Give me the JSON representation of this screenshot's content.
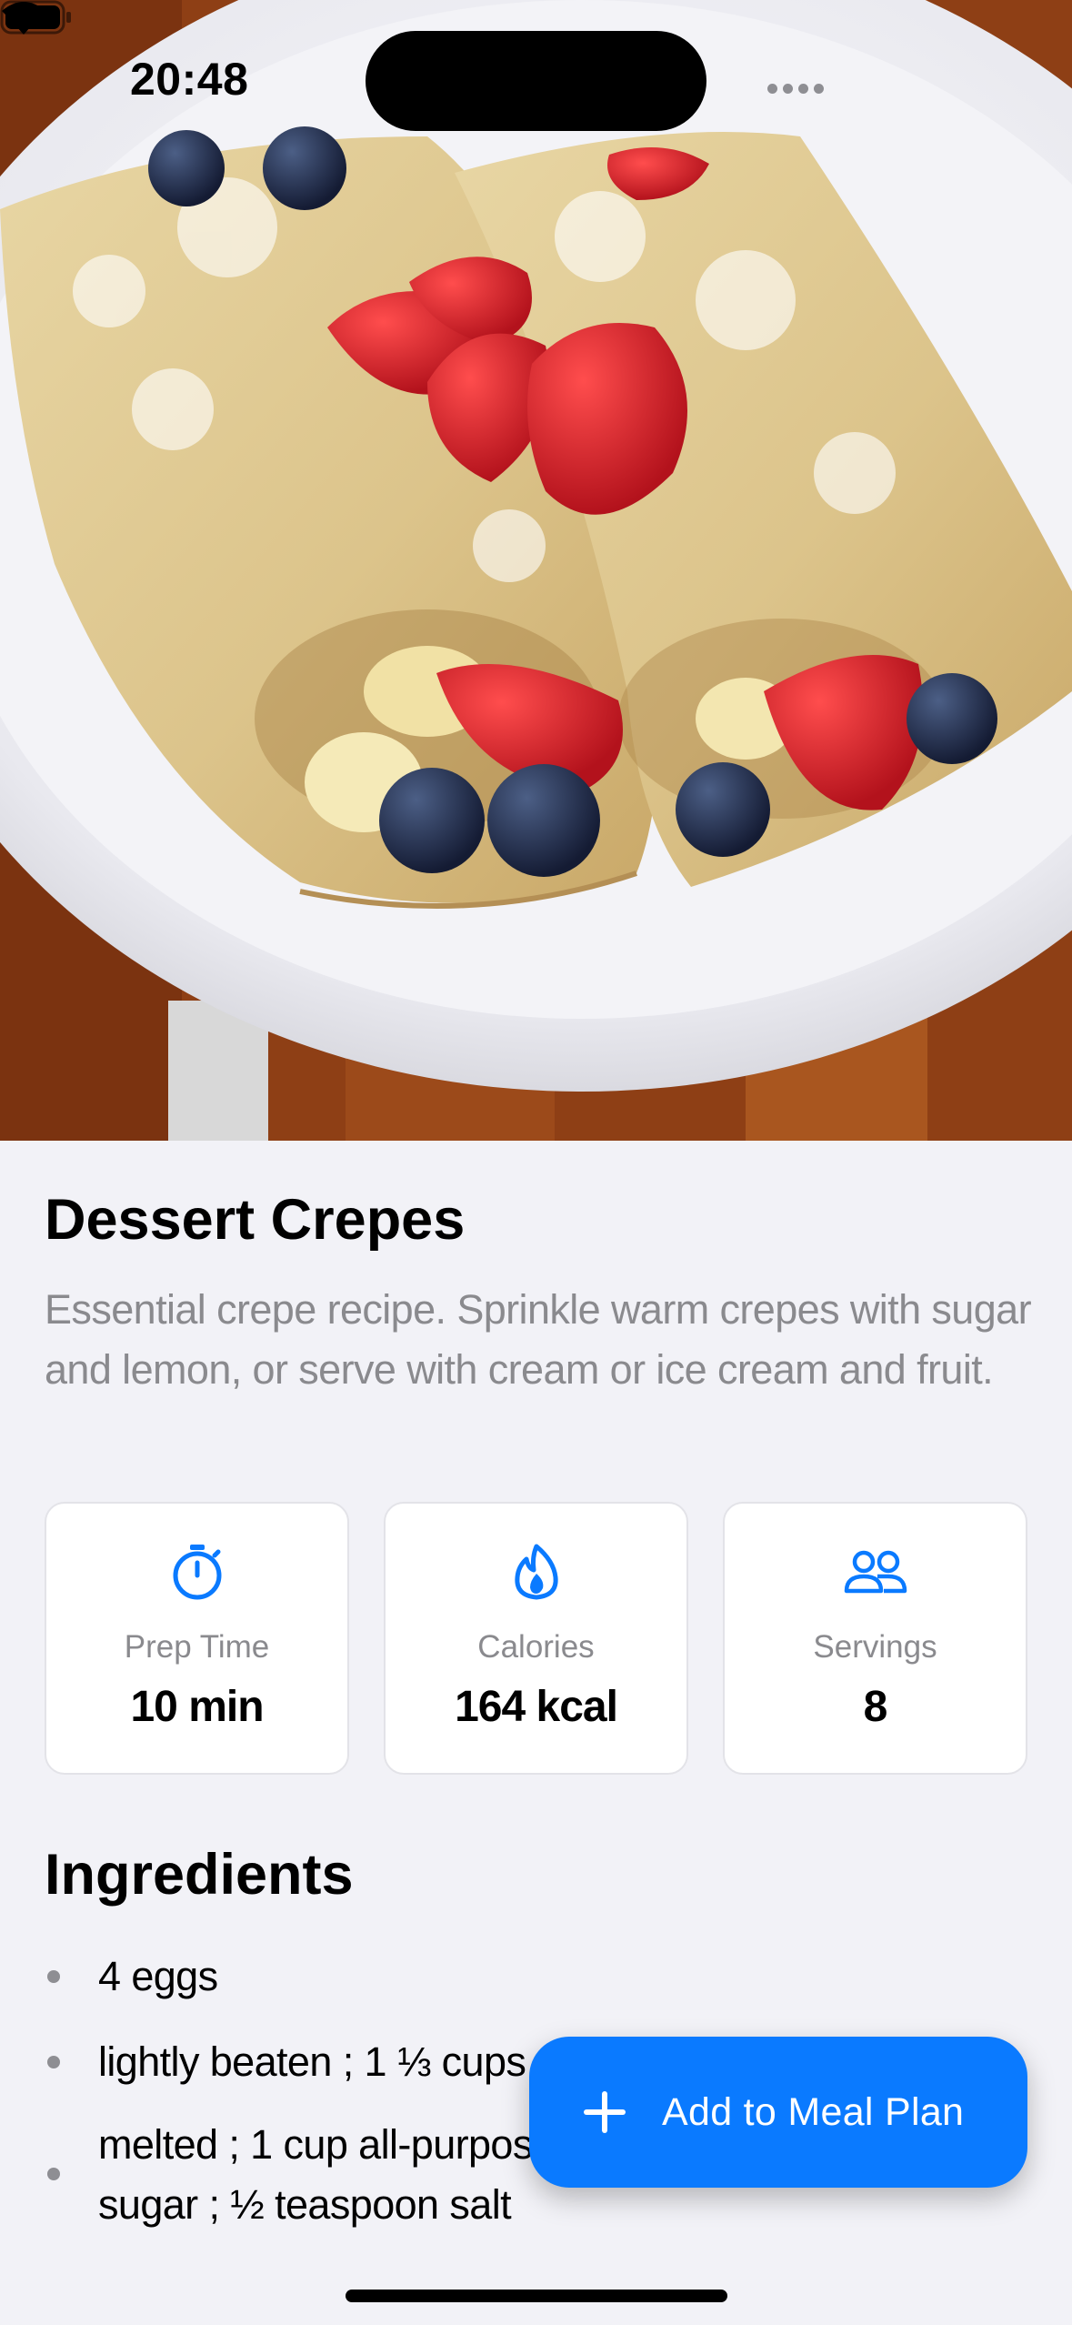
{
  "status_bar": {
    "time": "20:48"
  },
  "hero": {
    "image_alt": "Dessert crepes with strawberries, blueberries and banana on a white plate"
  },
  "recipe": {
    "title": "Dessert Crepes",
    "description": "Essential crepe recipe.  Sprinkle warm crepes with sugar and lemon, or serve with cream or ice cream and fruit."
  },
  "stats": [
    {
      "icon": "timer-icon",
      "label": "Prep Time",
      "value": "10 min"
    },
    {
      "icon": "flame-icon",
      "label": "Calories",
      "value": "164 kcal"
    },
    {
      "icon": "people-icon",
      "label": "Servings",
      "value": "8"
    }
  ],
  "ingredients": {
    "title": "Ingredients",
    "items": [
      "4  eggs",
      "lightly beaten ; 1 ⅓ cups milk ; 2 tablespoons butter,",
      "melted ; 1 cup all-purpose flour ; 2 tablespoons white sugar ; ½ teaspoon salt"
    ]
  },
  "fab": {
    "label": "Add to Meal Plan"
  },
  "colors": {
    "accent": "#0a7aff",
    "background": "#f2f2f7",
    "secondary_text": "#8a8a8e"
  }
}
